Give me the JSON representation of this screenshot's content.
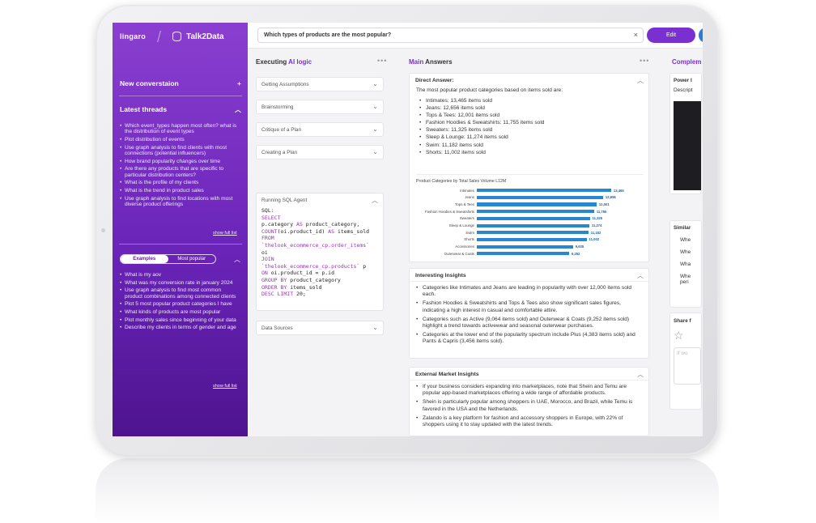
{
  "app": {
    "brand": "lingaro",
    "product": "Talk2Data"
  },
  "sidebar": {
    "new_conversation": "New converstaion",
    "latest_threads_title": "Latest threads",
    "threads": [
      "Which event_types happen most often? what is the distribution of event types",
      "Plot distribution of events",
      "Use graph analysis to find clients with most connections (potential influencers)",
      "How brand popularity changes over time",
      "Are there any products that are specific to particular distribution centers?",
      "What is the profile of my clients",
      "What is the trend in product sales",
      "Use graph analysis to find locations with most diverse product offerings"
    ],
    "show_full_list": "show full list",
    "tabs": [
      "Examples",
      "Most popular"
    ],
    "examples": [
      "What is my aov",
      "What was my conversion rate in january 2024",
      "Use graph analysis to find most common product combinations among connected clients",
      "Plot 5 most popular product categories I have",
      "What kinds of products are most popular",
      "Plot monthly sales since beginning of your data",
      "Describe my clients in terms of gender and age"
    ],
    "show_full_list_2": "show full list"
  },
  "topbar": {
    "question": "Which types of products are the most popular?",
    "edit_label": "Edit"
  },
  "executing": {
    "title_prefix": "Executing",
    "title_accent": "AI logic",
    "steps": [
      "Getting Assumptions",
      "Brainstorming",
      "Critique of a Plan",
      "Creating a Plan"
    ],
    "sql_agent_title": "Running SQL Agent",
    "data_sources": "Data Sources"
  },
  "main": {
    "title_accent": "Main",
    "title_rest": "Answers",
    "direct_answer": {
      "title": "Direct Answer:",
      "intro": "The most popular product categories based on items sold are:",
      "items": [
        "Intimates: 13,465 items sold",
        "Jeans: 12,656 items sold",
        "Tops & Tees: 12,001 items sold",
        "Fashion Hoodies & Sweatshirts: 11,755 items sold",
        "Sweaters: 11,325 items sold",
        "Sleep & Lounge: 11,274 items sold",
        "Swim: 11,182 items sold",
        "Shorts: 11,002 items sold"
      ]
    },
    "insights": {
      "title": "Interesting Insights",
      "items": [
        "Categories like Intimates and Jeans are leading in popularity with over 12,000 items sold each.",
        "Fashion Hoodies & Sweatshirts and Tops & Tees also show significant sales figures, indicating a high interest in casual and comfortable attire.",
        "Categories such as Active (9,064 items sold) and Outerwear & Coats (9,252 items sold) highlight a trend towards activewear and seasonal outerwear purchases.",
        "Categories at the lower end of the popularity spectrum include Plus (4,383 items sold) and Pants & Capris (3,456 items sold)."
      ]
    },
    "market": {
      "title": "External Market Insights",
      "items": [
        "If your business considers expanding into marketplaces, note that Shein and Temu are popular app-based marketplaces offering a wide range of affordable products.",
        "Shein is particularly popular among shoppers in UAE, Morocco, and Brazil, while Temu is favored in the USA and the Netherlands.",
        "Zalando is a key platform for fashion and accessory shoppers in Europe, with 22% of shoppers using it to stay updated with the latest trends."
      ]
    }
  },
  "right": {
    "title": "Complem",
    "power": "Power I",
    "descr": "Descript",
    "similar": "Similar",
    "similar_items": [
      "Whe",
      "Whe",
      "Wha",
      "Whe"
    ],
    "similar_extra": "peri",
    "share": "Share f",
    "input_placeholder": "If wo"
  },
  "chart_data": {
    "type": "bar",
    "title": "Product Categories by Total Sales Volume L12M",
    "categories": [
      "Intimates",
      "Jeans",
      "Tops & Tees",
      "Fashion Hoodies & Sweatshirts",
      "Sweaters",
      "Sleep & Lounge",
      "Swim",
      "Shorts",
      "Accessories",
      "Outerwear & Coats"
    ],
    "values": [
      13465,
      12656,
      12001,
      11755,
      11325,
      11274,
      11182,
      11002,
      9635,
      9252
    ],
    "value_labels": [
      "13,465",
      "12,656",
      "12,001",
      "11,755",
      "11,325",
      "11,274",
      "11,182",
      "11,002",
      "9,635",
      "9,252"
    ],
    "orientation": "horizontal",
    "xlim": [
      0,
      15000
    ],
    "colors": {
      "bar": "#2a86cf"
    }
  },
  "colors": {
    "accent": "#7a2fd0",
    "sidebar_top": "#8a3fd0",
    "sidebar_bottom": "#4e148f",
    "blue": "#2d7ad6"
  }
}
